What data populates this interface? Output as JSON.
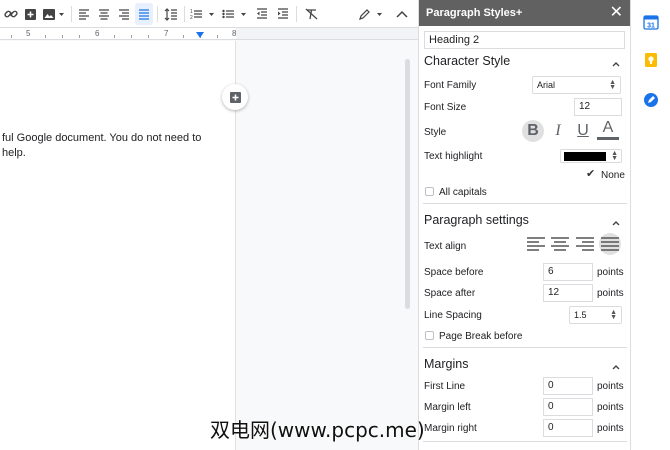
{
  "document": {
    "lines": [
      "ful Google document. You do not need to",
      "help."
    ]
  },
  "ruler": {
    "numbers": [
      "5",
      "6",
      "7",
      "8"
    ]
  },
  "panel": {
    "title": "Paragraph Styles+",
    "style_name": "Heading 2",
    "character_style": {
      "title": "Character Style",
      "font_family_label": "Font Family",
      "font_family_value": "Arial",
      "font_size_label": "Font Size",
      "font_size_value": "12",
      "style_label": "Style",
      "style_buttons": [
        "B",
        "I",
        "U",
        "A"
      ],
      "text_highlight_label": "Text highlight",
      "highlight_color": "#000000",
      "none_label": "None",
      "all_capitals_label": "All capitals"
    },
    "paragraph_settings": {
      "title": "Paragraph settings",
      "text_align_label": "Text align",
      "space_before_label": "Space before",
      "space_before_value": "6",
      "space_after_label": "Space after",
      "space_after_value": "12",
      "unit": "points",
      "line_spacing_label": "Line Spacing",
      "line_spacing_value": "1.5",
      "page_break_label": "Page Break before"
    },
    "margins": {
      "title": "Margins",
      "first_line_label": "First Line",
      "first_line_value": "0",
      "margin_left_label": "Margin left",
      "margin_left_value": "0",
      "margin_right_label": "Margin right",
      "margin_right_value": "0",
      "unit": "points"
    }
  },
  "watermark": "双电网(www.pcpc.me)",
  "colors": {
    "header": "#616161",
    "accent": "#1a73e8"
  }
}
